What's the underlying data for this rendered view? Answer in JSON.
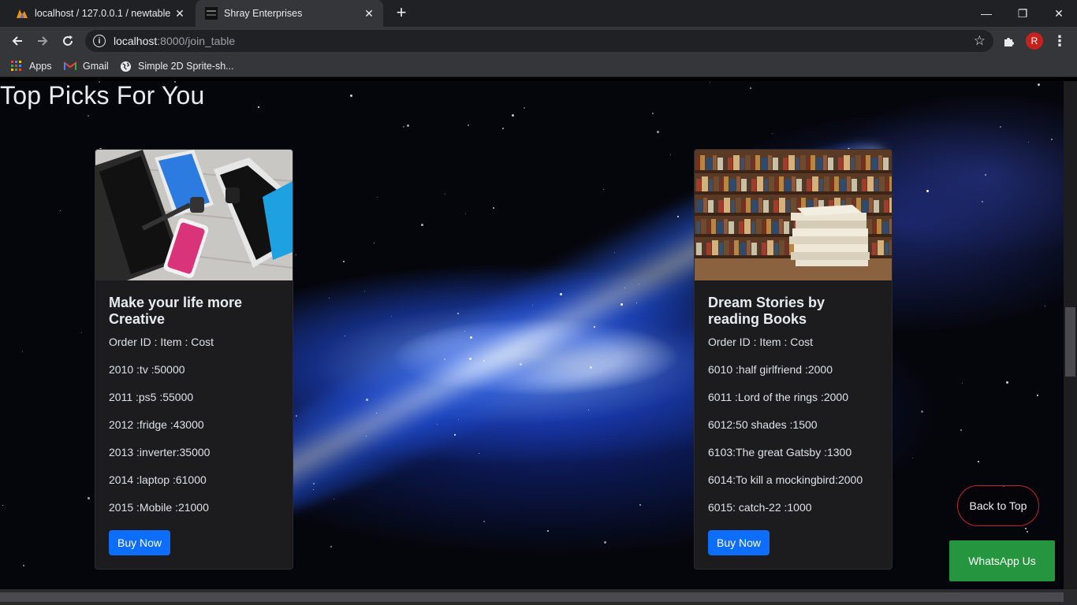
{
  "browser": {
    "tabs": [
      {
        "title": "localhost / 127.0.0.1 / newtable /",
        "active": false,
        "icon": "phpmyadmin-icon"
      },
      {
        "title": "Shray Enterprises",
        "active": true,
        "icon": "site-favicon"
      }
    ],
    "new_tab": "+",
    "window_controls": {
      "minimize": "—",
      "restore": "❐",
      "close": "✕"
    },
    "url_host": "localhost",
    "url_rest": ":8000/join_table",
    "avatar_letter": "R",
    "bookmarks": [
      {
        "label": "Apps",
        "icon": "apps-grid-icon"
      },
      {
        "label": "Gmail",
        "icon": "gmail-icon"
      },
      {
        "label": "Simple 2D Sprite-sh...",
        "icon": "globe-icon"
      }
    ]
  },
  "page": {
    "title": "Top Picks For You",
    "cards": [
      {
        "image": "gadgets-photo",
        "title": "Make your life more Creative",
        "lines": [
          "Order ID : Item : Cost",
          "2010 :tv :50000",
          "2011 :ps5 :55000",
          "2012 :fridge :43000",
          "2013 :inverter:35000",
          "2014 :laptop :61000",
          "2015 :Mobile :21000"
        ],
        "button": "Buy Now"
      },
      {
        "image": "books-photo",
        "title": "Dream Stories by reading Books",
        "lines": [
          "Order ID : Item : Cost",
          "6010 :half girlfriend :2000",
          "6011 :Lord of the rings :2000",
          "6012:50 shades :1500",
          "6103:The great Gatsby :1300",
          "6014:To kill a mockingbird:2000",
          "6015: catch-22 :1000"
        ],
        "button": "Buy Now"
      }
    ],
    "back_to_top": "Back to Top",
    "whatsapp": "WhatsApp Us"
  },
  "colors": {
    "button_primary": "#0d6efd",
    "whatsapp_green": "#25963f",
    "back_to_top_border": "#c0262d",
    "card_bg": "#1c1c1f"
  }
}
